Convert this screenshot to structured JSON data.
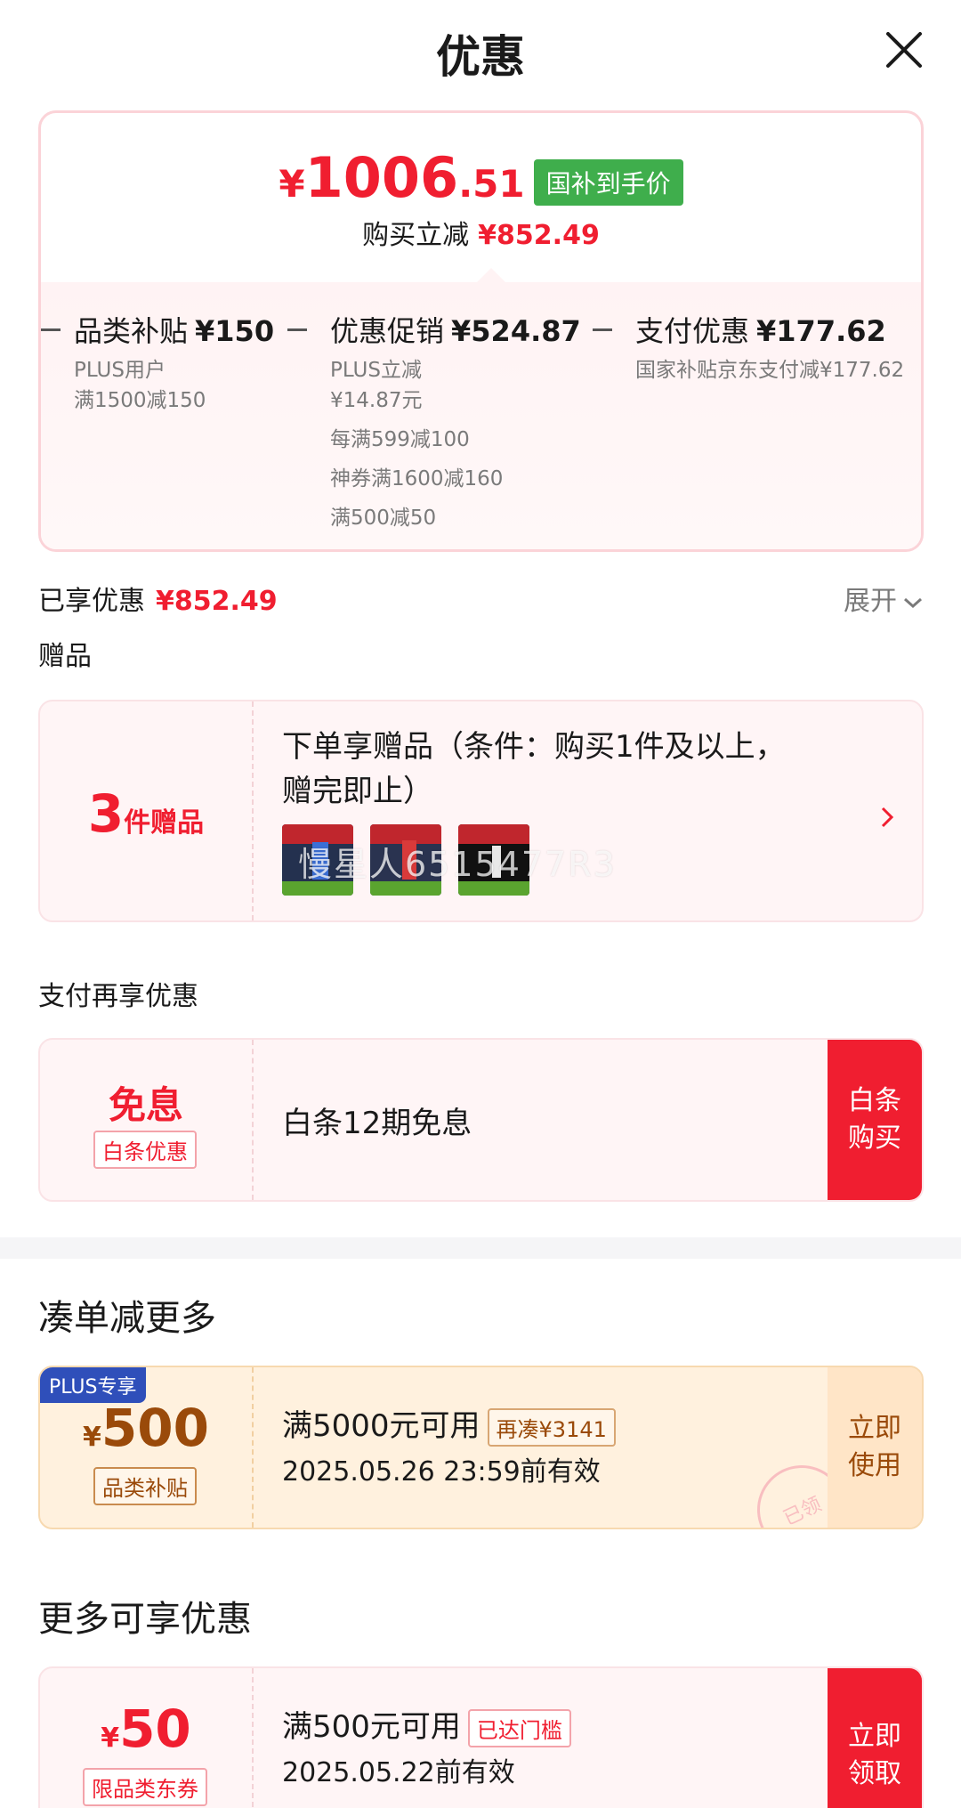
{
  "header": {
    "title": "优惠"
  },
  "price": {
    "currency": "¥",
    "integer": "1006",
    "decimal": ".51",
    "badge": "国补到手价",
    "reduce_label": "购买立减",
    "reduce_value": "¥852.49"
  },
  "breakdown": [
    {
      "title": "品类补贴",
      "amount": "¥150",
      "lines": [
        "PLUS用户",
        "满1500减150"
      ]
    },
    {
      "title": "优惠促销",
      "amount": "¥524.87",
      "lines": [
        "PLUS立减",
        "¥14.87元",
        "每满599减100",
        "神券满1600减160",
        "满500减50"
      ]
    },
    {
      "title": "支付优惠",
      "amount": "¥177.62",
      "lines": [
        "国家补贴京东支付减¥177.62"
      ]
    }
  ],
  "enjoyed": {
    "label": "已享优惠",
    "value": "¥852.49",
    "expand": "展开"
  },
  "gift": {
    "section": "赠品",
    "count": "3",
    "count_label": "件赠品",
    "desc_line1": "下单享赠品（条件：购买1件及以上，",
    "desc_line2": "赠完即止）",
    "watermark": "慢星人6515477R3"
  },
  "pay": {
    "section": "支付再享优惠",
    "big": "免息",
    "tag": "白条优惠",
    "main": "白条12期免息",
    "button": "白条购买"
  },
  "bundle": {
    "section": "凑单减更多",
    "badge": "PLUS专享",
    "currency": "¥",
    "amount": "500",
    "tag": "品类补贴",
    "cond": "满5000元可用",
    "chip": "再凑¥3141",
    "valid": "2025.05.26 23:59前有效",
    "button": "立即使用",
    "stamp": "已领"
  },
  "more": {
    "section": "更多可享优惠",
    "currency": "¥",
    "amount": "50",
    "tag": "限品类东券",
    "cond": "满500元可用",
    "chip": "已达门槛",
    "valid": "2025.05.22前有效",
    "button": "立即领取"
  },
  "colors": {
    "accent": "#f01e30",
    "green": "#3fae4c",
    "plus_blue": "#2f4fba",
    "gold": "#9a4a0a"
  }
}
